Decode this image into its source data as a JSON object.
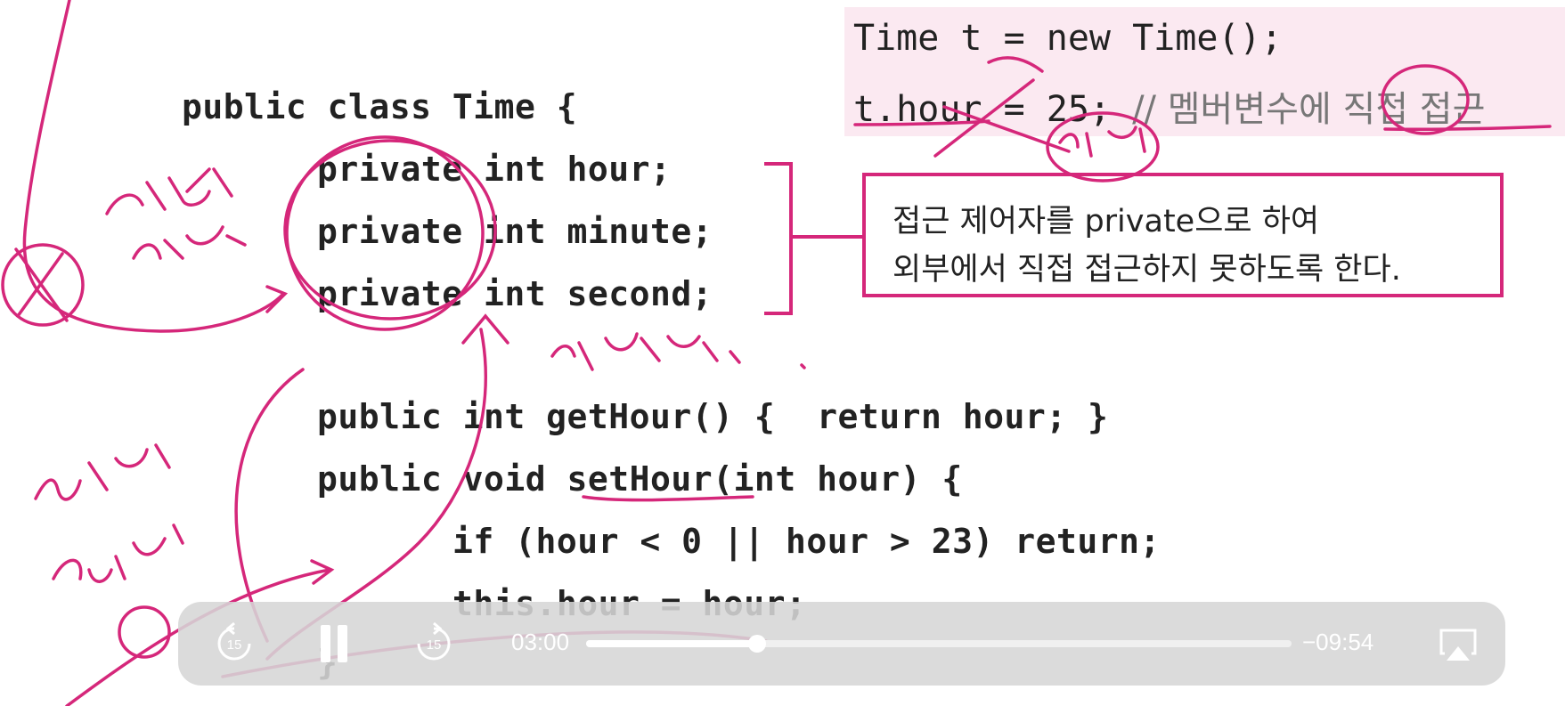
{
  "code": {
    "lines": [
      "public class Time {",
      "private int hour;",
      "private int minute;",
      "private int second;",
      "public int getHour() {  return hour; }",
      "public void setHour(int hour) {",
      "if (hour < 0 || hour > 23) return;",
      "this.hour = hour;",
      "}"
    ]
  },
  "top_example": {
    "line1": "Time t = new Time();",
    "line2_code": "t.hour = 25;",
    "line2_comment": "// 멤버변수에 직접 접근"
  },
  "note_box": {
    "line1": "접근 제어자를 private으로 하여",
    "line2": "외부에서 직접 접근하지 못하도록 한다."
  },
  "player": {
    "skip_back_label": "15",
    "skip_forward_label": "15",
    "elapsed": "03:00",
    "remaining": "−09:54",
    "progress": 0.242,
    "icons": {
      "skip_back": "rewind-15-icon",
      "pause": "pause-icon",
      "skip_forward": "forward-15-icon",
      "airplay": "airplay-icon"
    }
  },
  "colors": {
    "ink": "#d5277a",
    "player_bg": "#d6d6d6"
  }
}
